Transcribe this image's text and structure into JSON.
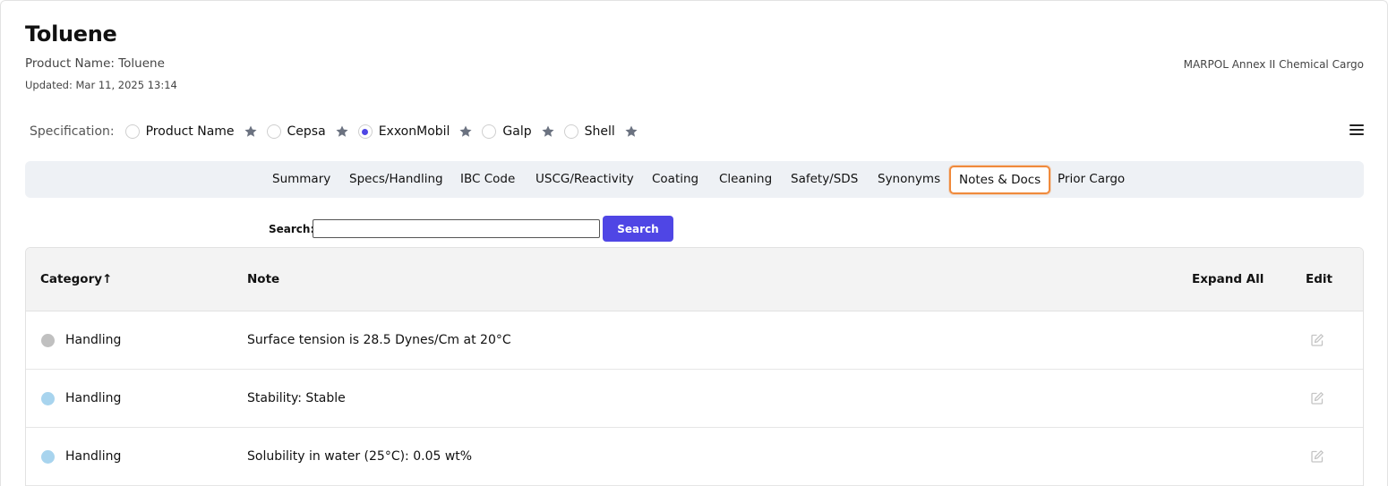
{
  "header": {
    "title": "Toluene",
    "product_name": "Product Name: Toluene",
    "updated": "Updated: Mar 11, 2025 13:14",
    "classification": "MARPOL Annex II Chemical Cargo"
  },
  "specification": {
    "label": "Specification:",
    "options": [
      {
        "label": "Product Name",
        "selected": false
      },
      {
        "label": "Cepsa",
        "selected": false
      },
      {
        "label": "ExxonMobil",
        "selected": true
      },
      {
        "label": "Galp",
        "selected": false
      },
      {
        "label": "Shell",
        "selected": false
      }
    ],
    "star_icon": "star-icon",
    "menu_icon": "hamburger-menu-icon"
  },
  "tabs": [
    {
      "label": "Summary"
    },
    {
      "label": "Specs/Handling"
    },
    {
      "label": "IBC Code"
    },
    {
      "label": "USCG/Reactivity"
    },
    {
      "label": "Coating"
    },
    {
      "label": "Cleaning"
    },
    {
      "label": "Safety/SDS"
    },
    {
      "label": "Synonyms"
    },
    {
      "label": "Notes & Docs",
      "active": true
    },
    {
      "label": "Prior Cargo"
    }
  ],
  "search": {
    "label": "Search:",
    "value": "",
    "button_label": "Search"
  },
  "table": {
    "columns": {
      "category": "Category↑",
      "note": "Note",
      "expand_all": "Expand All",
      "edit": "Edit"
    },
    "rows": [
      {
        "category": "Handling",
        "note": "Surface tension is 28.5 Dynes/Cm at 20°C",
        "dot_color": "#c0c0c0"
      },
      {
        "category": "Handling",
        "note": "Stability: Stable",
        "dot_color": "#a8d4ee"
      },
      {
        "category": "Handling",
        "note": "Solubility in water (25°C): 0.05 wt%",
        "dot_color": "#a8d4ee"
      }
    ]
  },
  "colors": {
    "accent": "#4f46e5",
    "active_tab_border": "#f08a3c",
    "tabbar_bg": "#eef1f5"
  }
}
